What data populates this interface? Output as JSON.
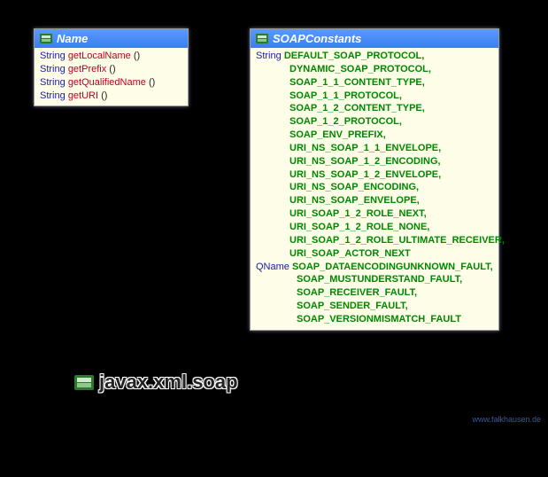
{
  "nameBox": {
    "title": "Name",
    "methods": [
      {
        "type": "String",
        "name": "getLocalName",
        "sig": "()"
      },
      {
        "type": "String",
        "name": "getPrefix",
        "sig": "()"
      },
      {
        "type": "String",
        "name": "getQualifiedName",
        "sig": "()"
      },
      {
        "type": "String",
        "name": "getURI",
        "sig": "()"
      }
    ]
  },
  "constBox": {
    "title": "SOAPConstants",
    "groups": [
      {
        "type": "String",
        "values": [
          "DEFAULT_SOAP_PROTOCOL,",
          "DYNAMIC_SOAP_PROTOCOL,",
          "SOAP_1_1_CONTENT_TYPE,",
          "SOAP_1_1_PROTOCOL,",
          "SOAP_1_2_CONTENT_TYPE,",
          "SOAP_1_2_PROTOCOL, SOAP_ENV_PREFIX,",
          "URI_NS_SOAP_1_1_ENVELOPE,",
          "URI_NS_SOAP_1_2_ENCODING,",
          "URI_NS_SOAP_1_2_ENVELOPE,",
          "URI_NS_SOAP_ENCODING,",
          "URI_NS_SOAP_ENVELOPE,",
          "URI_SOAP_1_2_ROLE_NEXT,",
          "URI_SOAP_1_2_ROLE_NONE,",
          "URI_SOAP_1_2_ROLE_ULTIMATE_RECEIVER,",
          "URI_SOAP_ACTOR_NEXT"
        ]
      },
      {
        "type": "QName",
        "values": [
          "SOAP_DATAENCODINGUNKNOWN_FAULT,",
          "SOAP_MUSTUNDERSTAND_FAULT,",
          "SOAP_RECEIVER_FAULT,",
          "SOAP_SENDER_FAULT,",
          "SOAP_VERSIONMISMATCH_FAULT"
        ]
      }
    ]
  },
  "package": "javax.xml.soap",
  "watermark": "www.falkhausen.de"
}
